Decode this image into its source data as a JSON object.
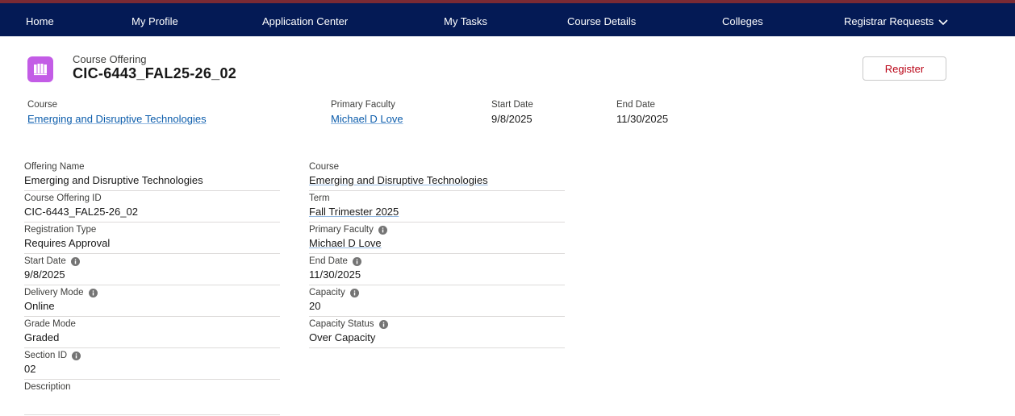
{
  "nav": {
    "items": [
      "Home",
      "My Profile",
      "Application Center",
      "My Tasks",
      "Course Details",
      "Colleges"
    ],
    "dropdown_label": "Registrar Requests"
  },
  "header": {
    "object_type": "Course Offering",
    "title": "CIC-6443_FAL25-26_02",
    "register_label": "Register",
    "icon": "book-icon"
  },
  "highlights": {
    "course_label": "Course",
    "course_value": "Emerging and Disruptive Technologies",
    "faculty_label": "Primary Faculty",
    "faculty_value": "Michael D Love",
    "start_label": "Start Date",
    "start_value": "9/8/2025",
    "end_label": "End Date",
    "end_value": "11/30/2025"
  },
  "left_fields": [
    {
      "label": "Offering Name",
      "value": "Emerging and Disruptive Technologies",
      "info": false,
      "link": false
    },
    {
      "label": "Course Offering ID",
      "value": "CIC-6443_FAL25-26_02",
      "info": false,
      "link": false
    },
    {
      "label": "Registration Type",
      "value": "Requires Approval",
      "info": false,
      "link": false
    },
    {
      "label": "Start Date",
      "value": "9/8/2025",
      "info": true,
      "link": false
    },
    {
      "label": "Delivery Mode",
      "value": "Online",
      "info": true,
      "link": false
    },
    {
      "label": "Grade Mode",
      "value": "Graded",
      "info": false,
      "link": false
    },
    {
      "label": "Section ID",
      "value": "02",
      "info": true,
      "link": false
    },
    {
      "label": "Description",
      "value": "",
      "info": false,
      "link": false
    }
  ],
  "right_fields": [
    {
      "label": "Course",
      "value": "Emerging and Disruptive Technologies",
      "info": false,
      "link": true
    },
    {
      "label": "Term",
      "value": "Fall Trimester 2025",
      "info": false,
      "link": true
    },
    {
      "label": "Primary Faculty",
      "value": "Michael D Love",
      "info": true,
      "link": true
    },
    {
      "label": "End Date",
      "value": "11/30/2025",
      "info": true,
      "link": false
    },
    {
      "label": "Capacity",
      "value": "20",
      "info": true,
      "link": false
    },
    {
      "label": "Capacity Status",
      "value": "Over Capacity",
      "info": true,
      "link": false
    }
  ],
  "colors": {
    "nav_bg": "#041a55",
    "accent_icon": "#c35ce6",
    "link": "#0b5cab",
    "register_text": "#ba0517"
  }
}
